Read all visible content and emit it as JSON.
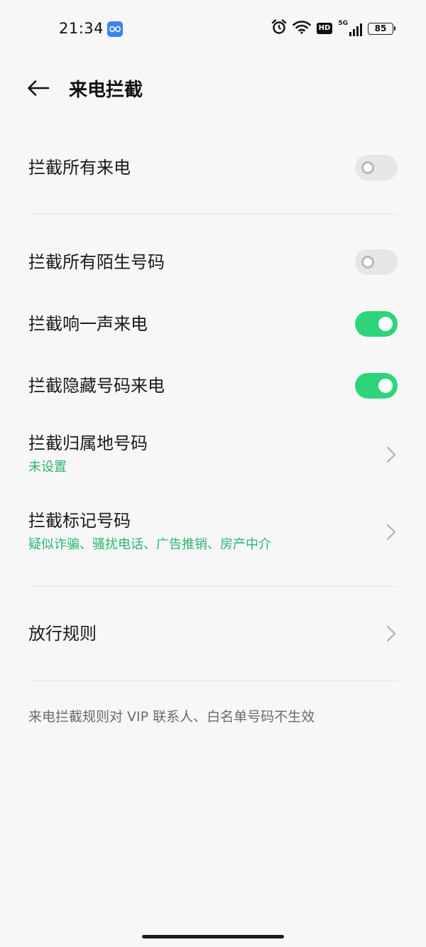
{
  "status_bar": {
    "time": "21:34",
    "battery": "85",
    "hd": "HD",
    "network": "5G",
    "icons": [
      "app-link-icon",
      "alarm-icon",
      "wifi-icon",
      "hd-icon",
      "signal-icon",
      "battery-icon"
    ]
  },
  "header": {
    "title": "来电拦截",
    "back_icon": "arrow-left-icon"
  },
  "settings": {
    "block_all_calls": {
      "label": "拦截所有来电",
      "enabled": false
    },
    "block_unknown": {
      "label": "拦截所有陌生号码",
      "enabled": false
    },
    "block_one_ring": {
      "label": "拦截响一声来电",
      "enabled": true
    },
    "block_hidden": {
      "label": "拦截隐藏号码来电",
      "enabled": true
    },
    "block_region": {
      "label": "拦截归属地号码",
      "subtitle": "未设置"
    },
    "block_marked": {
      "label": "拦截标记号码",
      "subtitle": "疑似诈骗、骚扰电话、广告推销、房产中介"
    },
    "allow_rules": {
      "label": "放行规则"
    }
  },
  "footnote": "来电拦截规则对 VIP 联系人、白名单号码不生效",
  "colors": {
    "accent_green": "#2ed47a",
    "subtitle_green": "#2bb673",
    "background": "#f7f7f7",
    "toggle_off": "#e6e6e6"
  }
}
